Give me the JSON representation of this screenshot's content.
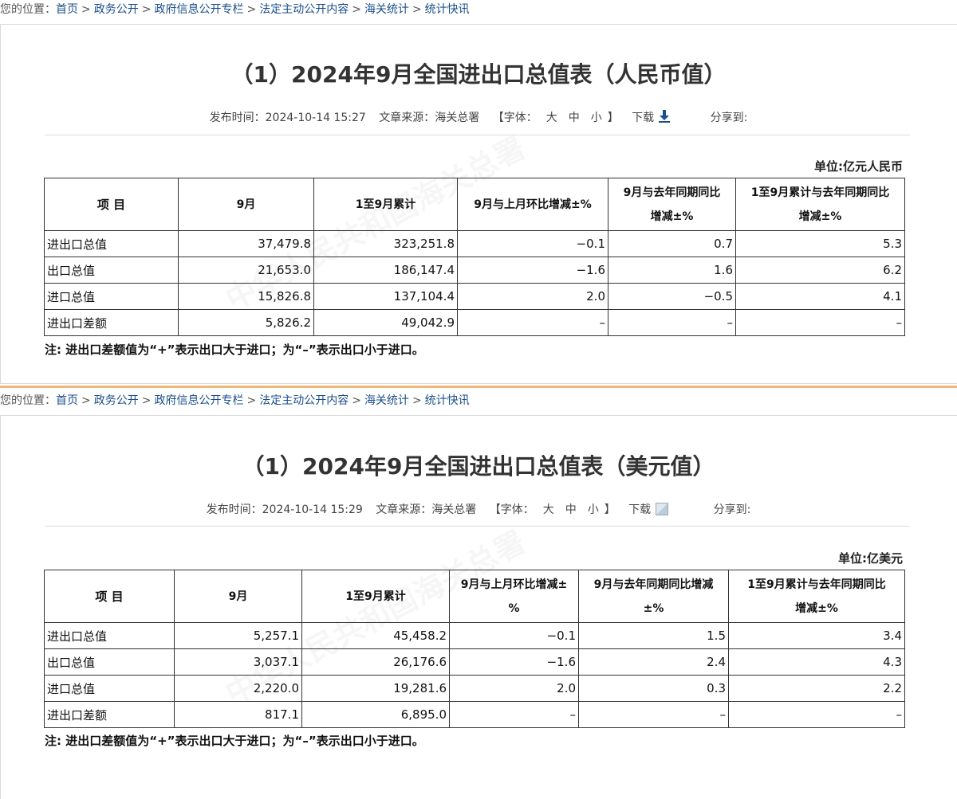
{
  "breadcrumb": {
    "prefix": "您的位置：",
    "items": [
      "首页",
      "政务公开",
      "政府信息公开专栏",
      "法定主动公开内容",
      "海关统计",
      "统计快讯"
    ]
  },
  "articles": [
    {
      "title": "（1）2024年9月全国进出口总值表（人民币值）",
      "publish_label": "发布时间：",
      "publish_time": "2024-10-14 15:27",
      "source_label": "文章来源：",
      "source": "海关总署",
      "font_open": "【字体：",
      "font_large": "大",
      "font_medium": "中",
      "font_small": "小",
      "font_close": "】",
      "download": "下载",
      "share": "分享到:",
      "unit": "单位:亿元人民币",
      "headers": [
        "项  目",
        "9月",
        "1至9月累计",
        "9月与上月环比增减±%",
        "9月与去年同期同比\n增减±%",
        "1至9月累计与去年同期同比\n增减±%"
      ],
      "rows": [
        [
          "进出口总值",
          "37,479.8",
          "323,251.8",
          "−0.1",
          "0.7",
          "5.3"
        ],
        [
          "出口总值",
          "21,653.0",
          "186,147.4",
          "−1.6",
          "1.6",
          "6.2"
        ],
        [
          "进口总值",
          "15,826.8",
          "137,104.4",
          "2.0",
          "−0.5",
          "4.1"
        ],
        [
          "进出口差额",
          "5,826.2",
          "49,042.9",
          "–",
          "–",
          "–"
        ]
      ],
      "note": "注: 进出口差额值为“+”表示出口大于进口；为“–”表示出口小于进口。"
    },
    {
      "title": "（1）2024年9月全国进出口总值表（美元值）",
      "publish_label": "发布时间：",
      "publish_time": "2024-10-14 15:29",
      "source_label": "文章来源：",
      "source": "海关总署",
      "font_open": "【字体：",
      "font_large": "大",
      "font_medium": "中",
      "font_small": "小",
      "font_close": "】",
      "download": "下载",
      "share": "分享到:",
      "unit": "单位:亿美元",
      "headers": [
        "项  目",
        "9月",
        "1至9月累计",
        "9月与上月环比增减±\n%",
        "9月与去年同期同比增减\n±%",
        "1至9月累计与去年同期同比\n增减±%"
      ],
      "rows": [
        [
          "进出口总值",
          "5,257.1",
          "45,458.2",
          "−0.1",
          "1.5",
          "3.4"
        ],
        [
          "出口总值",
          "3,037.1",
          "26,176.6",
          "−1.6",
          "2.4",
          "4.3"
        ],
        [
          "进口总值",
          "2,220.0",
          "19,281.6",
          "2.0",
          "0.3",
          "2.2"
        ],
        [
          "进出口差额",
          "817.1",
          "6,895.0",
          "–",
          "–",
          "–"
        ]
      ],
      "note": "注: 进出口差额值为“+”表示出口大于进口；为“–”表示出口小于进口。"
    }
  ],
  "colors": {
    "link": "#1a4e8c",
    "divider": "#f0b878",
    "download_icon": "#1a4e8c"
  },
  "icons": {
    "download": "download-arrow-icon",
    "broken_image": "broken-image-icon"
  }
}
